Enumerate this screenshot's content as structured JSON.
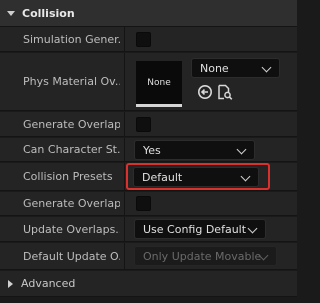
{
  "section": {
    "title": "Collision"
  },
  "rows": {
    "simulation": {
      "label": "Simulation Gener..."
    },
    "phys_material": {
      "label": "Phys Material Ov...",
      "thumbnail_text": "None",
      "dropdown_value": "None"
    },
    "generate_overlap_1": {
      "label": "Generate Overlap..."
    },
    "can_character": {
      "label": "Can Character St...",
      "value": "Yes"
    },
    "collision_presets": {
      "label": "Collision Presets",
      "value": "Default"
    },
    "generate_overlap_2": {
      "label": "Generate Overlap..."
    },
    "update_overlaps": {
      "label": "Update Overlaps...",
      "value": "Use Config Default"
    },
    "default_update": {
      "label": "Default Update O...",
      "value": "Only Update Movable"
    }
  },
  "advanced": {
    "title": "Advanced"
  },
  "icons": {
    "use_selected": "return-arrow-icon",
    "browse": "browse-asset-icon",
    "collapse": "collapse-arrow-icon",
    "expand": "expand-arrow-icon"
  },
  "colors": {
    "highlight": "#d9312e"
  }
}
